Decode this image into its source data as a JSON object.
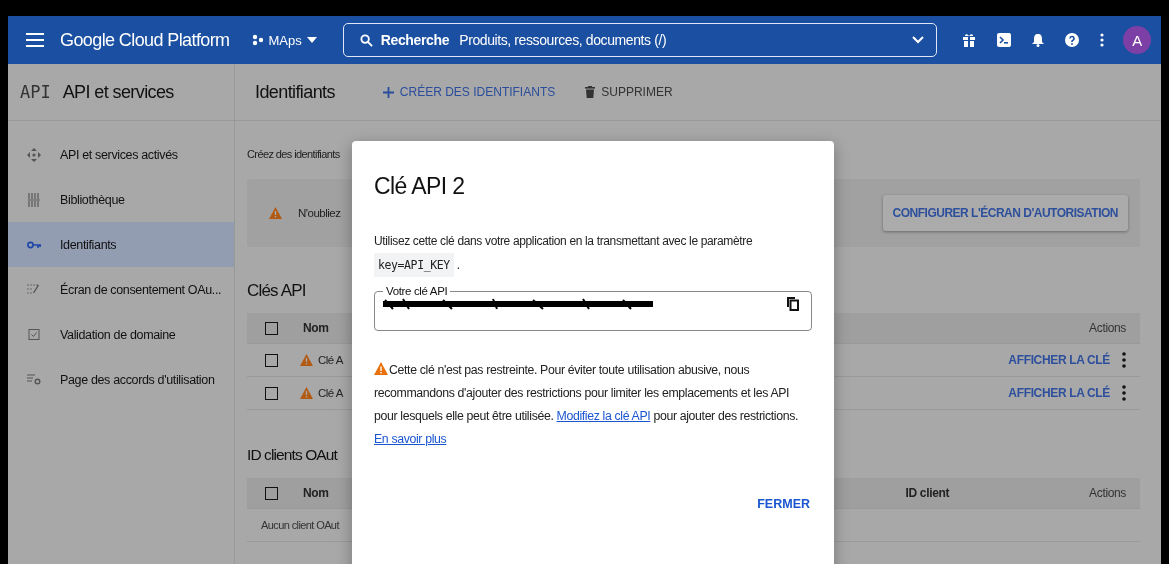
{
  "topbar": {
    "title": "Google Cloud Platform",
    "project": "MAps",
    "search": {
      "label": "Recherche",
      "placeholder": "Produits, ressources, documents (/)"
    },
    "avatar": "A"
  },
  "sidebar": {
    "logo": "API",
    "title": "API et services",
    "items": [
      {
        "label": "API et services activés",
        "selected": false
      },
      {
        "label": "Bibliothèque",
        "selected": false
      },
      {
        "label": "Identifiants",
        "selected": true
      },
      {
        "label": "Écran de consentement OAu...",
        "selected": false
      },
      {
        "label": "Validation de domaine",
        "selected": false
      },
      {
        "label": "Page des accords d'utilisation",
        "selected": false
      }
    ]
  },
  "page": {
    "title": "Identifiants",
    "actions": [
      {
        "label": "CRÉER DES IDENTIFIANTS",
        "kind": "create"
      },
      {
        "label": "SUPPRIMER",
        "kind": "delete"
      }
    ],
    "intro": "Créez des identifiants",
    "notice": {
      "text": "N'oubliez",
      "button": "CONFIGURER L'ÉCRAN D'AUTORISATION"
    },
    "api_keys": {
      "title": "Clés API",
      "all_checked": false,
      "columns": [
        "Nom",
        "Actions"
      ],
      "rows": [
        {
          "name": "Clé A",
          "action": "AFFICHER LA CLÉ",
          "checked": false
        },
        {
          "name": "Clé A",
          "action": "AFFICHER LA CLÉ",
          "checked": false
        }
      ]
    },
    "oauth": {
      "title": "ID clients OAut",
      "all_checked": false,
      "columns": [
        "Nom",
        "ID client",
        "Actions"
      ],
      "empty": "Aucun client OAut"
    }
  },
  "dialog": {
    "title": "Clé API 2",
    "intro": "Utilisez cette clé dans votre application en la transmettant avec le paramètre",
    "code": "key=API_KEY",
    "code_after": ".",
    "field_label": "Votre clé API",
    "warning": "Cette clé n'est pas restreinte. Pour éviter toute utilisation abusive, nous recommandons d'ajouter des restrictions pour limiter les emplacements et les API pour lesquels elle peut être utilisée.",
    "link_edit": "Modifiez la clé API",
    "middle": "pour ajouter des restrictions.",
    "link_more": "En savoir plus",
    "close": "FERMER"
  }
}
